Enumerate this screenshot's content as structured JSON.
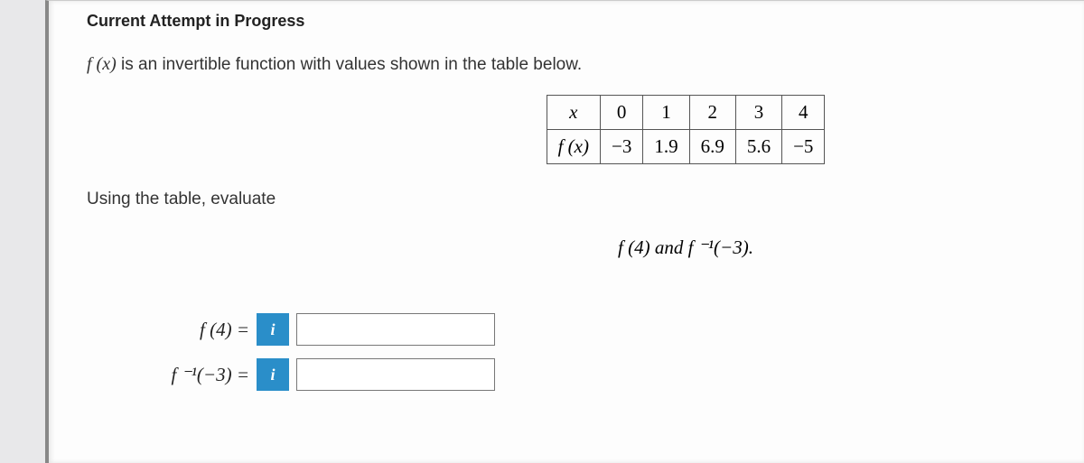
{
  "header": "Current Attempt in Progress",
  "intro_prefix": "f (x)",
  "intro_rest": " is an invertible function with values shown in the table below.",
  "table": {
    "row1_hdr": "x",
    "row1": [
      "0",
      "1",
      "2",
      "3",
      "4"
    ],
    "row2_hdr": "f (x)",
    "row2": [
      "−3",
      "1.9",
      "6.9",
      "5.6",
      "−5"
    ]
  },
  "using": "Using the table, evaluate",
  "eval_target": "f (4) and f ⁻¹(−3).",
  "answers": {
    "r1_label": "f (4) =",
    "r2_label": "f ⁻¹(−3) =",
    "info_glyph": "i",
    "r1_value": "",
    "r2_value": ""
  },
  "colors": {
    "info_bg": "#2a8ec9"
  }
}
